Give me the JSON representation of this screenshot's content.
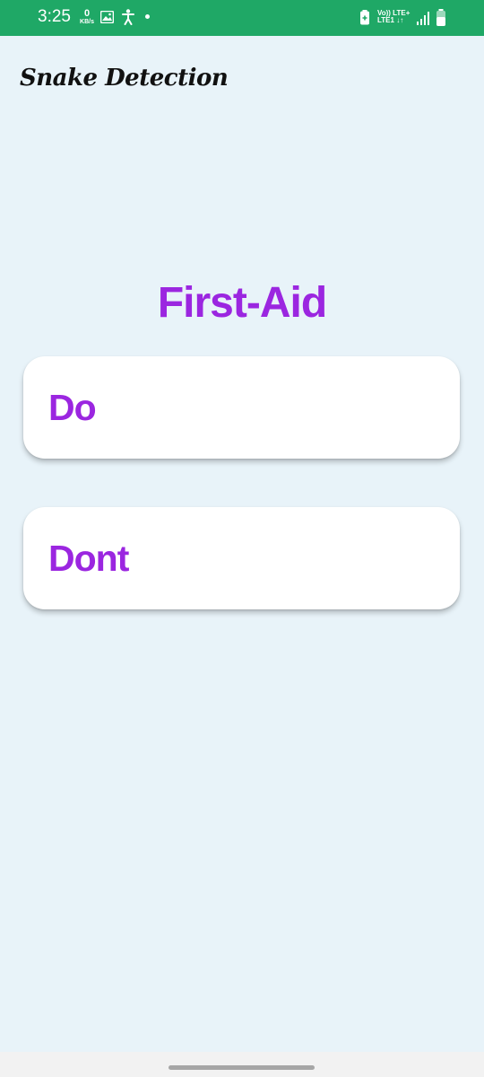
{
  "status_bar": {
    "time": "3:25",
    "net_speed_value": "0",
    "net_speed_unit": "KB/s",
    "network_line1": "Vo)) LTE+",
    "network_line2": "LTE1 ↓↑",
    "background_color": "#1fa866"
  },
  "app_bar": {
    "title": "Snake Detection"
  },
  "main": {
    "heading": "First-Aid",
    "accent_color": "#9b26e0",
    "options": [
      {
        "label": "Do"
      },
      {
        "label": "Dont"
      }
    ]
  },
  "icons": [
    "gallery-icon",
    "accessibility-icon",
    "battery-saver-icon",
    "signal-icon",
    "battery-icon"
  ]
}
